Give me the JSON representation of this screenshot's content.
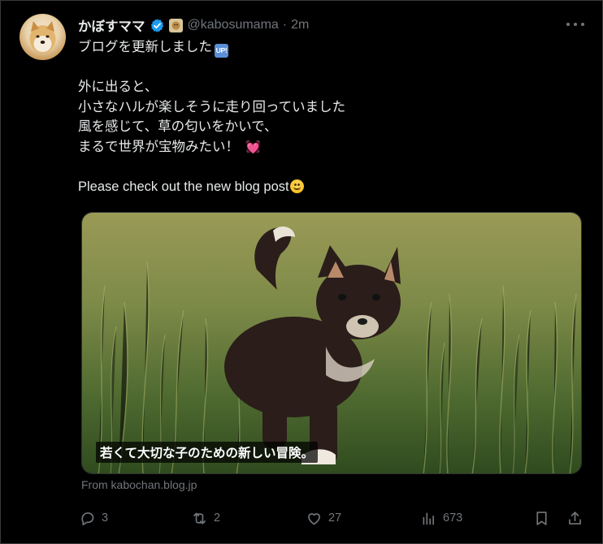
{
  "tweet": {
    "display_name": "かぼすママ",
    "handle": "@kabosumama",
    "separator": "·",
    "time": "2m",
    "lines": [
      "ブログを更新しました",
      "",
      "外に出ると、",
      "小さなハルが楽しそうに走り回っていました",
      "風を感じて、草の匂いをかいで、",
      "まるで世界が宝物みたい！",
      "",
      "Please check out the new blog post"
    ],
    "up_badge": "UP!",
    "heart_emoji": "💓"
  },
  "card": {
    "caption": "若くて大切な子のための新しい冒険。",
    "source": "From kabochan.blog.jp"
  },
  "actions": {
    "replies": "3",
    "retweets": "2",
    "likes": "27",
    "views": "673"
  },
  "colors": {
    "background": "#000000",
    "text": "#e7e9ea",
    "muted": "#71767b",
    "verified": "#1d9bf0"
  },
  "icons": [
    "more-icon",
    "verified-icon",
    "org-badge-icon",
    "reply-icon",
    "retweet-icon",
    "like-icon",
    "views-icon",
    "bookmark-icon",
    "share-icon"
  ]
}
